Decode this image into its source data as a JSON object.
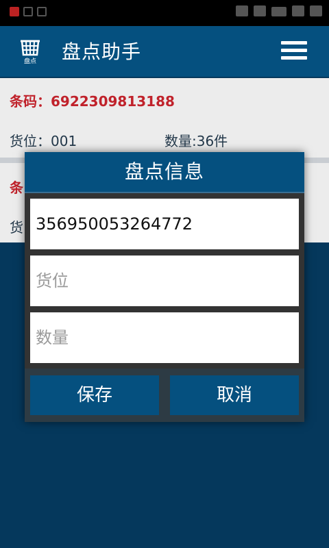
{
  "app": {
    "logo_text": "盘点",
    "title": "盘点助手"
  },
  "records": [
    {
      "barcode": "条码：6922309813188",
      "location": "货位：001",
      "quantity": "数量:36件"
    },
    {
      "barcode": "条",
      "location": "货"
    }
  ],
  "dialog": {
    "title": "盘点信息",
    "barcode_value": "356950053264772",
    "location_placeholder": "货位",
    "quantity_placeholder": "数量",
    "save_label": "保存",
    "cancel_label": "取消"
  },
  "colors": {
    "primary": "#05507f",
    "background": "#05385c",
    "barcode_red": "#c0222b",
    "list_bg": "#ececec"
  }
}
